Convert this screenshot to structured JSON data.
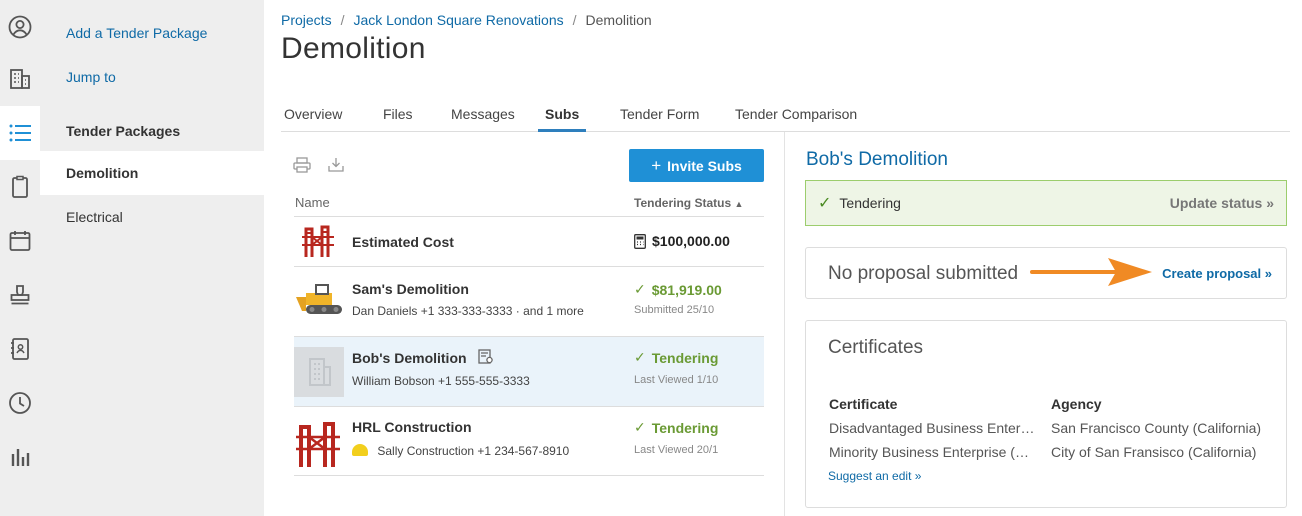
{
  "rail": {
    "items": [
      {
        "icon": "user-circle-icon"
      },
      {
        "icon": "building-icon"
      },
      {
        "icon": "list-icon",
        "active": true
      },
      {
        "icon": "clipboard-icon"
      },
      {
        "icon": "calendar-icon"
      },
      {
        "icon": "stamp-icon"
      },
      {
        "icon": "address-book-icon"
      },
      {
        "icon": "clock-icon"
      },
      {
        "icon": "bar-chart-icon"
      }
    ]
  },
  "sidebar": {
    "add_package": "Add a Tender Package",
    "jump_to": "Jump to",
    "heading": "Tender Packages",
    "items": [
      {
        "label": "Demolition",
        "active": true
      },
      {
        "label": "Electrical",
        "active": false
      }
    ]
  },
  "breadcrumb": {
    "items": [
      "Projects",
      "Jack London Square Renovations",
      "Demolition"
    ],
    "separator": "/"
  },
  "page_title": "Demolition",
  "tabs": [
    "Overview",
    "Files",
    "Messages",
    "Subs",
    "Tender Form",
    "Tender Comparison"
  ],
  "active_tab": "Subs",
  "list": {
    "invite_button": "Invite Subs",
    "col_name": "Name",
    "col_status": "Tendering Status",
    "rows": [
      {
        "name": "Estimated Cost",
        "contact": "",
        "status": "$100,000.00",
        "sub": "",
        "icon": "calculator-icon"
      },
      {
        "name": "Sam's Demolition",
        "contact": "Dan Daniels +1 333-333-3333 · and 1 more",
        "status": "$81,919.00",
        "sub": "Submitted 25/10",
        "icon": "check-icon"
      },
      {
        "name": "Bob's Demolition",
        "contact": "William Bobson +1 555-555-3333",
        "status": "Tendering",
        "sub": "Last Viewed 1/10",
        "icon": "check-icon",
        "selected": true
      },
      {
        "name": "HRL Construction",
        "contact": "Sally Construction +1 234-567-8910",
        "status": "Tendering",
        "sub": "Last Viewed 20/1",
        "icon": "check-icon"
      }
    ]
  },
  "detail": {
    "title": "Bob's Demolition",
    "status": "Tendering",
    "update_status": "Update status »",
    "proposal_text": "No proposal submitted",
    "create_proposal": "Create proposal »",
    "certificates": {
      "title": "Certificates",
      "col_certificate": "Certificate",
      "col_agency": "Agency",
      "rows": [
        {
          "certificate": "Disadvantaged Business Enterprise",
          "agency": "San Francisco County (California)"
        },
        {
          "certificate": "Minority Business Enterprise (MBE)",
          "agency": "City of San Fransisco (California)"
        }
      ],
      "suggest_edit": "Suggest an edit »"
    }
  },
  "colors": {
    "accent_blue": "#0f6aa6",
    "button_blue": "#1f90d6",
    "status_green": "#6a9a34",
    "arrow_orange": "#f08a24"
  }
}
